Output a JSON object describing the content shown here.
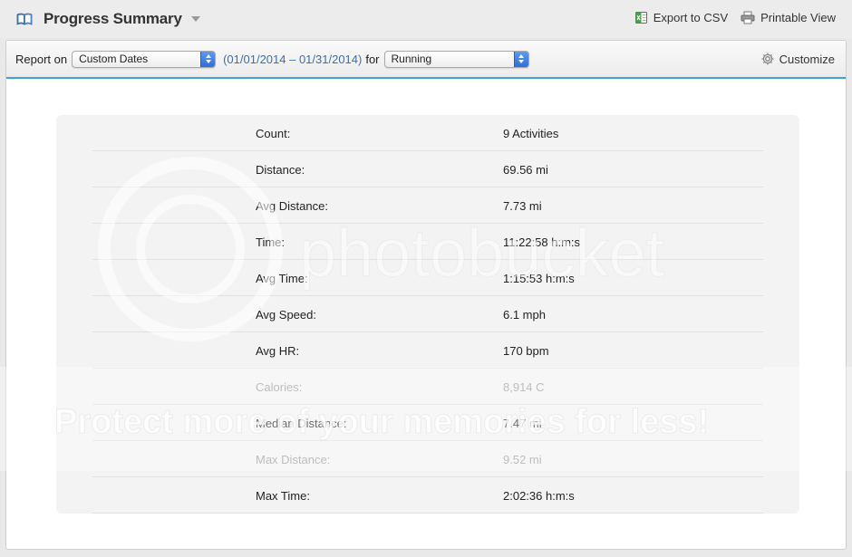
{
  "header": {
    "title": "Progress Summary",
    "export_label": "Export to CSV",
    "print_label": "Printable View"
  },
  "toolbar": {
    "report_on_label": "Report on",
    "date_mode": "Custom Dates",
    "date_range": "(01/01/2014 – 01/31/2014)",
    "for_label": "for",
    "activity_type": "Running",
    "customize_label": "Customize"
  },
  "summary": {
    "rows": [
      {
        "label": "Count:",
        "value": "9 Activities"
      },
      {
        "label": "Distance:",
        "value": "69.56 mi"
      },
      {
        "label": "Avg Distance:",
        "value": "7.73 mi"
      },
      {
        "label": "Time:",
        "value": "11:22:58 h:m:s"
      },
      {
        "label": "Avg Time:",
        "value": "1:15:53 h:m:s"
      },
      {
        "label": "Avg Speed:",
        "value": "6.1 mph"
      },
      {
        "label": "Avg HR:",
        "value": "170 bpm"
      },
      {
        "label": "Calories:",
        "value": "8,914 C"
      },
      {
        "label": "Median Distance:",
        "value": "7.47 mi"
      },
      {
        "label": "Max Distance:",
        "value": "9.52 mi"
      },
      {
        "label": "Max Time:",
        "value": "2:02:36 h:m:s"
      }
    ]
  },
  "watermark": {
    "brand": "photobucket",
    "tagline": "Protect more of your memories for less!"
  },
  "colors": {
    "accent": "#3aa2d8",
    "link": "#3a6fb5",
    "select_arrows": "#2f6fd6"
  }
}
